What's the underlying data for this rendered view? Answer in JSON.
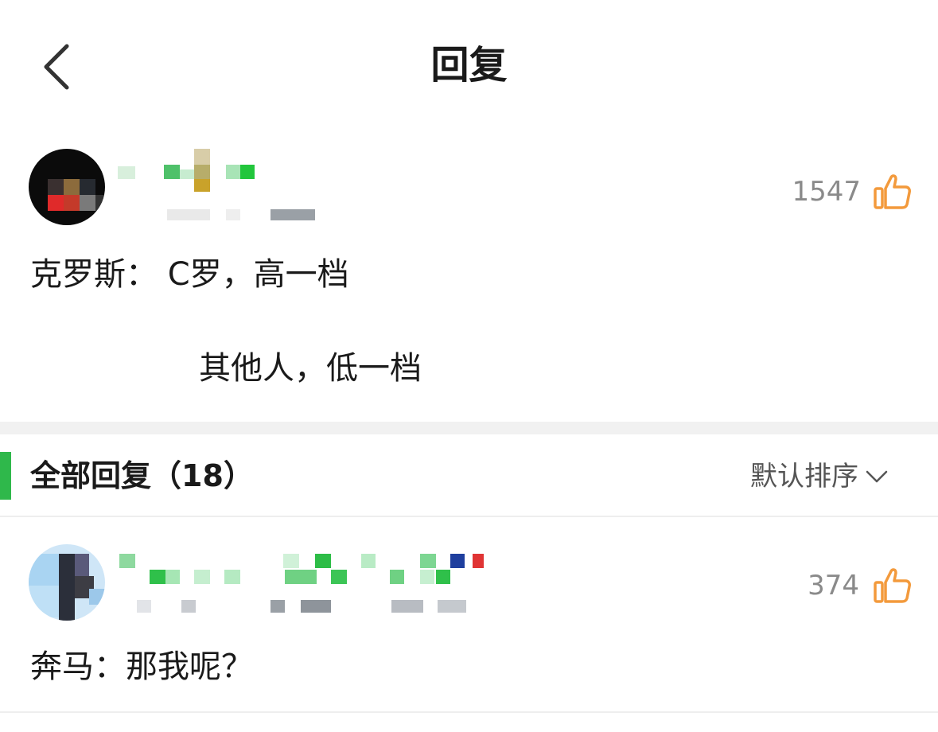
{
  "nav": {
    "title": "回复"
  },
  "main_comment": {
    "like_count": "1547",
    "text_line1": "克罗斯： C罗，高一档",
    "text_line2": "其他人，低一档"
  },
  "replies": {
    "title": "全部回复（18）",
    "sort_label": "默认排序",
    "accent_color": "#2fb84b"
  },
  "reply_items": [
    {
      "like_count": "374",
      "text": "奔马：那我呢？"
    }
  ],
  "icons": {
    "back": "chevron-left-icon",
    "like": "thumbs-up-icon",
    "sort": "chevron-down-icon"
  },
  "colors": {
    "like_icon": "#f39a3c",
    "accent": "#2fb84b"
  }
}
